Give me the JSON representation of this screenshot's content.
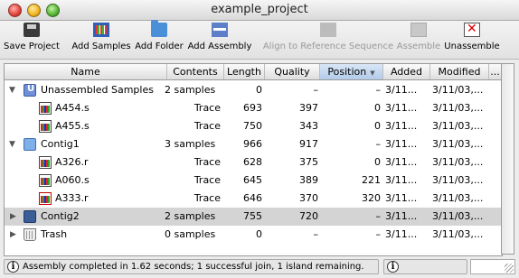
{
  "window": {
    "title": "example_project"
  },
  "toolbar": {
    "buttons": [
      {
        "label": "Save Project",
        "icon": "save-disk-icon",
        "enabled": true
      },
      {
        "label": "Add Samples",
        "icon": "add-samples-icon",
        "enabled": true
      },
      {
        "label": "Add Folder",
        "icon": "add-folder-icon",
        "enabled": true
      },
      {
        "label": "Add Assembly",
        "icon": "add-assembly-icon",
        "enabled": true
      },
      {
        "label": "Align to Reference Sequence",
        "icon": "align-reference-icon",
        "enabled": false
      },
      {
        "label": "Assemble",
        "icon": "assemble-icon",
        "enabled": false
      },
      {
        "label": "Unassemble",
        "icon": "unassemble-icon",
        "enabled": true
      }
    ]
  },
  "table": {
    "columns": [
      "Name",
      "Contents",
      "Length",
      "Quality",
      "Position",
      "Added",
      "Modified",
      "..."
    ],
    "sorted_column": "Position",
    "rows": [
      {
        "name": "Unassembled Samples",
        "contents": "2 samples",
        "length": "0",
        "quality": "–",
        "position": "–",
        "added": "3/11...",
        "modified": "3/11/03,...",
        "level": 0,
        "expanded": true,
        "icon": "unassembled-folder-icon"
      },
      {
        "name": "A454.s",
        "contents": "Trace",
        "length": "693",
        "quality": "397",
        "position": "0",
        "added": "3/11...",
        "modified": "3/11/03,...",
        "level": 1,
        "icon": "trace-icon"
      },
      {
        "name": "A455.s",
        "contents": "Trace",
        "length": "750",
        "quality": "343",
        "position": "0",
        "added": "3/11...",
        "modified": "3/11/03,...",
        "level": 1,
        "icon": "trace-icon"
      },
      {
        "name": "Contig1",
        "contents": "3 samples",
        "length": "966",
        "quality": "917",
        "position": "–",
        "added": "3/11...",
        "modified": "3/11/03,...",
        "level": 0,
        "expanded": true,
        "icon": "contig-folder-icon"
      },
      {
        "name": "A326.r",
        "contents": "Trace",
        "length": "628",
        "quality": "375",
        "position": "0",
        "added": "3/11...",
        "modified": "3/11/03,...",
        "level": 1,
        "icon": "trace-icon"
      },
      {
        "name": "A060.s",
        "contents": "Trace",
        "length": "645",
        "quality": "389",
        "position": "221",
        "added": "3/11...",
        "modified": "3/11/03,...",
        "level": 1,
        "icon": "trace-icon"
      },
      {
        "name": "A333.r",
        "contents": "Trace",
        "length": "646",
        "quality": "370",
        "position": "320",
        "added": "3/11...",
        "modified": "3/11/03,...",
        "level": 1,
        "icon": "trace-reverse-icon"
      },
      {
        "name": "Contig2",
        "contents": "2 samples",
        "length": "755",
        "quality": "720",
        "position": "–",
        "added": "3/11...",
        "modified": "3/11/03,...",
        "level": 0,
        "expanded": false,
        "selected": true,
        "icon": "contig-folder-dark-icon"
      },
      {
        "name": "Trash",
        "contents": "0 samples",
        "length": "0",
        "quality": "–",
        "position": "–",
        "added": "3/11...",
        "modified": "3/11/03,...",
        "level": 0,
        "expanded": false,
        "icon": "trash-icon"
      }
    ]
  },
  "status": {
    "message": "Assembly completed in 1.62 seconds; 1 successful join, 1 island remaining.",
    "info_glyph": "i"
  },
  "glyphs": {
    "tri_open": "▼",
    "tri_closed": "▶",
    "sort_arrow": "▼"
  }
}
